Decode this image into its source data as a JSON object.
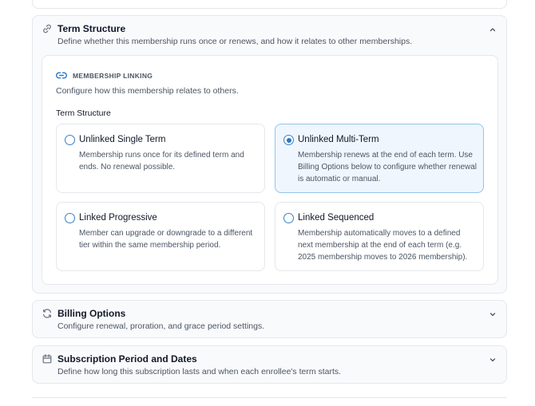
{
  "term_structure": {
    "title": "Term Structure",
    "description": "Define whether this membership runs once or renews, and how it relates to other memberships.",
    "icon": "link-icon",
    "expanded": true,
    "linking": {
      "eyebrow": "MEMBERSHIP LINKING",
      "description": "Configure how this membership relates to others.",
      "field_label": "Term Structure",
      "selected": "Unlinked Multi-Term",
      "options": [
        {
          "title": "Unlinked Single Term",
          "description": "Membership runs once for its defined term and ends. No renewal possible.",
          "selected": false
        },
        {
          "title": "Unlinked Multi-Term",
          "description": "Membership renews at the end of each term. Use Billing Options below to configure whether renewal is automatic or manual.",
          "selected": true
        },
        {
          "title": "Linked Progressive",
          "description": "Member can upgrade or downgrade to a different tier within the same membership period.",
          "selected": false
        },
        {
          "title": "Linked Sequenced",
          "description": "Membership automatically moves to a defined next membership at the end of each term (e.g. 2025 membership moves to 2026 membership).",
          "selected": false
        }
      ]
    }
  },
  "billing_options": {
    "title": "Billing Options",
    "description": "Configure renewal, proration, and grace period settings.",
    "icon": "refresh-icon",
    "expanded": false
  },
  "subscription_period": {
    "title": "Subscription Period and Dates",
    "description": "Define how long this subscription lasts and when each enrollee's term starts.",
    "icon": "calendar-icon",
    "expanded": false
  },
  "colors": {
    "accent": "#2878c8",
    "selected_bg": "#eff6fd",
    "border": "#e5e7eb",
    "section_bg": "#f9fafb"
  }
}
